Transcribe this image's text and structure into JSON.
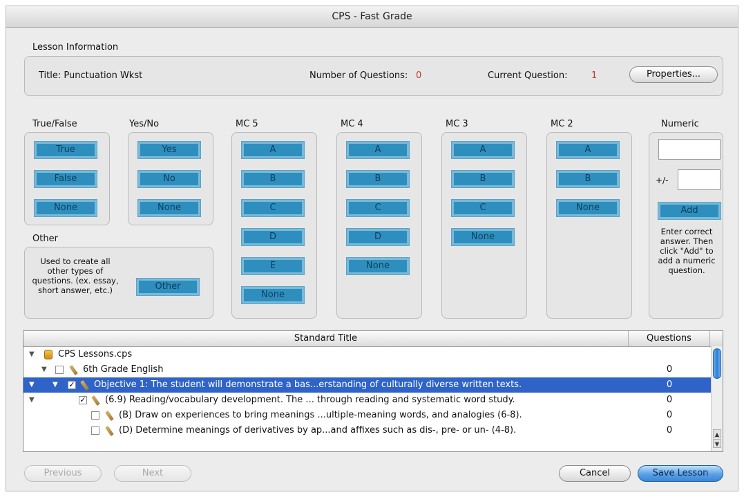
{
  "window": {
    "title": "CPS - Fast Grade"
  },
  "lesson": {
    "section_label": "Lesson Information",
    "title_text": "Title: Punctuation Wkst",
    "num_questions_label": "Number of Questions:",
    "num_questions_value": "0",
    "current_question_label": "Current Question:",
    "current_question_value": "1",
    "properties_button": "Properties..."
  },
  "answer_groups": {
    "true_false": {
      "label": "True/False",
      "buttons": [
        "True",
        "False",
        "None"
      ]
    },
    "yes_no": {
      "label": "Yes/No",
      "buttons": [
        "Yes",
        "No",
        "None"
      ]
    },
    "mc5": {
      "label": "MC 5",
      "buttons": [
        "A",
        "B",
        "C",
        "D",
        "E",
        "None"
      ]
    },
    "mc4": {
      "label": "MC 4",
      "buttons": [
        "A",
        "B",
        "C",
        "D",
        "None"
      ]
    },
    "mc3": {
      "label": "MC 3",
      "buttons": [
        "A",
        "B",
        "C",
        "None"
      ]
    },
    "mc2": {
      "label": "MC 2",
      "buttons": [
        "A",
        "B",
        "None"
      ]
    },
    "numeric": {
      "label": "Numeric",
      "value": "",
      "tolerance_label": "+/-",
      "tolerance_value": "",
      "add_button": "Add",
      "hint": "Enter correct answer. Then click \"Add\" to add a numeric question."
    },
    "other": {
      "label": "Other",
      "description": "Used to create all other types of questions. (ex. essay, short answer, etc.)",
      "button": "Other"
    }
  },
  "tree": {
    "columns": [
      "Standard Title",
      "Questions"
    ],
    "rows": [
      {
        "text": "CPS Lessons.cps",
        "questions": ""
      },
      {
        "text": "6th Grade English",
        "questions": "0"
      },
      {
        "text": "Objective 1: The student will demonstrate a bas...erstanding of culturally diverse written texts.",
        "questions": "0"
      },
      {
        "text": "(6.9)  Reading/vocabulary development. The ... through reading and systematic word study.",
        "questions": "0"
      },
      {
        "text": "(B) Draw on experiences to bring meanings ...ultiple-meaning words, and analogies (6-8).",
        "questions": "0"
      },
      {
        "text": "(D) Determine meanings of derivatives by ap...and affixes such as dis-, pre- or un- (4-8).",
        "questions": "0"
      }
    ]
  },
  "footer": {
    "previous": "Previous",
    "next": "Next",
    "cancel": "Cancel",
    "save": "Save Lesson"
  },
  "colors": {
    "answer_button": "#2e8fbf",
    "selection": "#2f63c8",
    "count_red": "#c0392b"
  }
}
